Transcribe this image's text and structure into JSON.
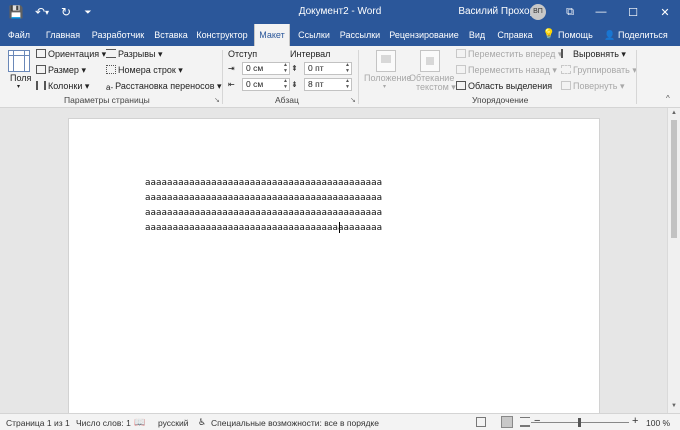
{
  "window": {
    "title": "Документ2 - Word",
    "user_name": "Василий Прохоров",
    "user_initials": "ВП",
    "minimize": "—",
    "maximize": "☐",
    "close": "✕",
    "ribbon_display": "⧉"
  },
  "quick_access": {
    "save": "💾",
    "undo": "↶",
    "undo_more": "▾",
    "redo": "↻",
    "customize": "⏷"
  },
  "tabs": {
    "file": "Файл",
    "home": "Главная",
    "developer": "Разработчик",
    "insert": "Вставка",
    "design": "Конструктор",
    "layout": "Макет",
    "references": "Ссылки",
    "mailings": "Рассылки",
    "review": "Рецензирование",
    "view": "Вид",
    "help": "Справка",
    "tell_me": "Помощь",
    "share": "Поделиться"
  },
  "ribbon": {
    "page_setup": {
      "margins": "Поля",
      "orientation": "Ориентация",
      "size": "Размер",
      "columns": "Колонки",
      "breaks": "Разрывы",
      "line_numbers": "Номера строк",
      "hyphenation": "Расстановка переносов",
      "group_label": "Параметры страницы"
    },
    "paragraph": {
      "indent_label": "Отступ",
      "spacing_label": "Интервал",
      "indent_left": "0 см",
      "indent_right": "0 см",
      "spacing_before": "0 пт",
      "spacing_after": "8 пт",
      "group_label": "Абзац"
    },
    "arrange": {
      "position": "Положение",
      "wrap_text_1": "Обтекание",
      "wrap_text_2": "текстом",
      "bring_forward": "Переместить вперед",
      "send_backward": "Переместить назад",
      "selection_pane": "Область выделения",
      "align": "Выровнять",
      "group": "Группировать",
      "rotate": "Повернуть",
      "group_label": "Упорядочение"
    },
    "collapse": "^"
  },
  "document": {
    "lines": [
      "ааааааааааааааааааааааааааааааааааааааааааа",
      "ааааааааааааааааааааааааааааааааааааааааааа",
      "ааааааааааааааааааааааааааааааааааааааааааа",
      "ааааааааааааааааааааааааааааааааааааааааааа"
    ]
  },
  "status": {
    "page": "Страница 1 из 1",
    "words": "Число слов: 1",
    "language": "русский",
    "accessibility": "Специальные возможности: все в порядке",
    "zoom_out": "−",
    "zoom_in": "+",
    "zoom": "100 %"
  },
  "colors": {
    "accent": "#2b579a",
    "ribbon": "#f3f3f3",
    "canvas": "#e6e6e6"
  }
}
